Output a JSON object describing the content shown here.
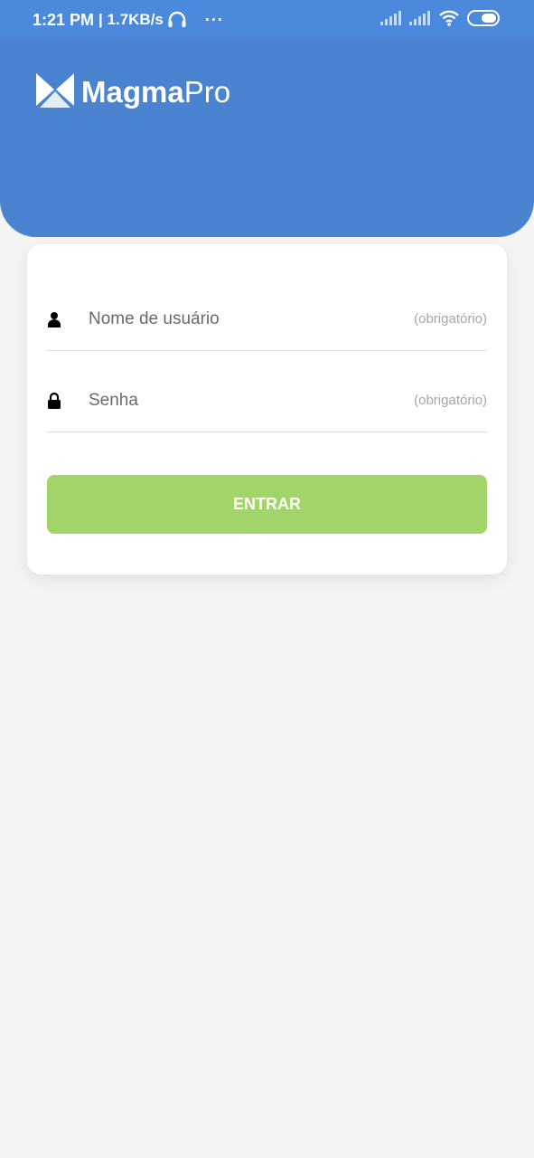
{
  "status_bar": {
    "time": "1:21 PM",
    "speed": "| 1.7KB/s",
    "more": "···"
  },
  "header": {
    "logo_text_bold": "Magma",
    "logo_text_light": "Pro",
    "background_color": "#4a83cf"
  },
  "login": {
    "username": {
      "placeholder": "Nome de usuário",
      "required_label": "(obrigatório)",
      "icon": "user-icon"
    },
    "password": {
      "placeholder": "Senha",
      "required_label": "(obrigatório)",
      "icon": "lock-icon"
    },
    "submit_label": "ENTRAR",
    "submit_color": "#a1d469"
  }
}
